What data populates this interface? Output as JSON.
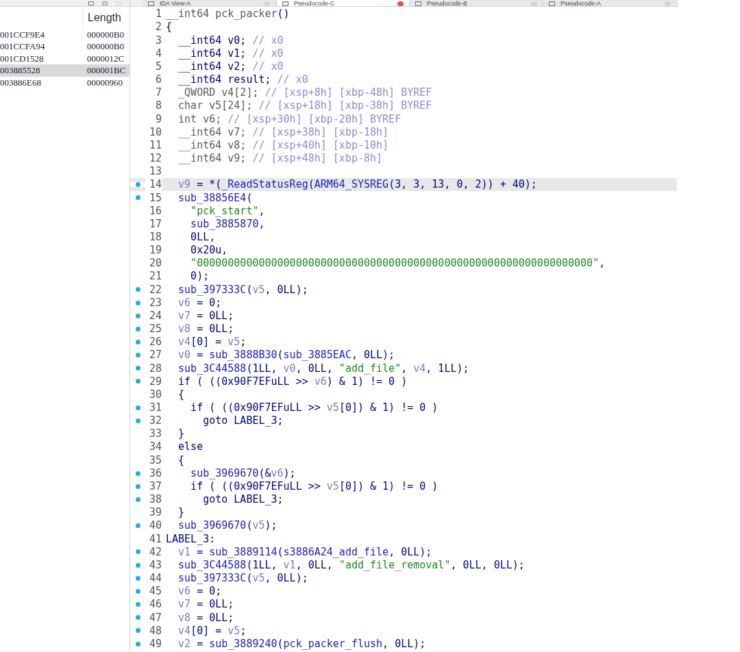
{
  "tabs": [
    {
      "label": "IDA View-A",
      "selected": false
    },
    {
      "label": "Pseudocode-C",
      "selected": true
    },
    {
      "label": "Pseudocode-B",
      "selected": false
    },
    {
      "label": "Pseudocode-A",
      "selected": false
    }
  ],
  "segments": {
    "length_header": "Length",
    "rows": [
      {
        "column_1": "001CCF9E4",
        "length": "000000B0",
        "selected": false
      },
      {
        "column_1": "001CCFA94",
        "length": "000000B0",
        "selected": false
      },
      {
        "column_1": "001CD1528",
        "length": "0000012C",
        "selected": false
      },
      {
        "column_1": "003885528",
        "length": "000001BC",
        "selected": true
      },
      {
        "column_1": "003886E68",
        "length": "00000960",
        "selected": false
      }
    ]
  },
  "code": [
    {
      "num": "1",
      "dot": false,
      "selected": false,
      "tokens": [
        {
          "kind": "gray",
          "text": "__int64 pck_packer"
        },
        {
          "kind": "plain",
          "text": "()"
        }
      ]
    },
    {
      "num": "2",
      "dot": false,
      "selected": false,
      "tokens": [
        {
          "kind": "plain",
          "text": "{"
        }
      ]
    },
    {
      "num": "3",
      "dot": false,
      "selected": false,
      "tokens": [
        {
          "kind": "plain",
          "text": "  __int64 v0; "
        },
        {
          "kind": "comment",
          "text": "// x0"
        }
      ]
    },
    {
      "num": "4",
      "dot": false,
      "selected": false,
      "tokens": [
        {
          "kind": "plain",
          "text": "  __int64 v1; "
        },
        {
          "kind": "comment",
          "text": "// x0"
        }
      ]
    },
    {
      "num": "5",
      "dot": false,
      "selected": false,
      "tokens": [
        {
          "kind": "plain",
          "text": "  __int64 v2; "
        },
        {
          "kind": "comment",
          "text": "// x0"
        }
      ]
    },
    {
      "num": "6",
      "dot": false,
      "selected": false,
      "tokens": [
        {
          "kind": "plain",
          "text": "  __int64 result; "
        },
        {
          "kind": "comment",
          "text": "// x0"
        }
      ]
    },
    {
      "num": "7",
      "dot": false,
      "selected": false,
      "tokens": [
        {
          "kind": "gray",
          "text": "  _QWORD v4[2]; "
        },
        {
          "kind": "comment",
          "text": "// [xsp+8h] [xbp-48h] BYREF"
        }
      ]
    },
    {
      "num": "8",
      "dot": false,
      "selected": false,
      "tokens": [
        {
          "kind": "gray",
          "text": "  char v5[24]; "
        },
        {
          "kind": "comment",
          "text": "// [xsp+18h] [xbp-38h] BYREF"
        }
      ]
    },
    {
      "num": "9",
      "dot": false,
      "selected": false,
      "tokens": [
        {
          "kind": "gray",
          "text": "  int v6; "
        },
        {
          "kind": "comment",
          "text": "// [xsp+30h] [xbp-20h] BYREF"
        }
      ]
    },
    {
      "num": "10",
      "dot": false,
      "selected": false,
      "tokens": [
        {
          "kind": "gray",
          "text": "  __int64 v7; "
        },
        {
          "kind": "comment",
          "text": "// [xsp+38h] [xbp-18h]"
        }
      ]
    },
    {
      "num": "11",
      "dot": false,
      "selected": false,
      "tokens": [
        {
          "kind": "gray",
          "text": "  __int64 v8; "
        },
        {
          "kind": "comment",
          "text": "// [xsp+40h] [xbp-10h]"
        }
      ]
    },
    {
      "num": "12",
      "dot": false,
      "selected": false,
      "tokens": [
        {
          "kind": "gray",
          "text": "  __int64 v9; "
        },
        {
          "kind": "comment",
          "text": "// [xsp+48h] [xbp-8h]"
        }
      ]
    },
    {
      "num": "13",
      "dot": false,
      "selected": false
    },
    {
      "num": "14",
      "dot": true,
      "selected": true,
      "tokens": [
        {
          "kind": "var",
          "text": "  v9"
        },
        {
          "kind": "plain",
          "text": " = *("
        },
        {
          "kind": "name",
          "text": "_ReadStatusReg"
        },
        {
          "kind": "plain",
          "text": "("
        },
        {
          "kind": "name",
          "text": "ARM64_SYSREG"
        },
        {
          "kind": "plain",
          "text": "(3, 3, 13, 0, 2)) + 40);"
        }
      ]
    },
    {
      "num": "15",
      "dot": true,
      "selected": false,
      "tokens": [
        {
          "kind": "name",
          "text": "  sub_38856E4"
        },
        {
          "kind": "plain",
          "text": "("
        }
      ]
    },
    {
      "num": "16",
      "dot": false,
      "selected": false,
      "tokens": [
        {
          "kind": "string",
          "text": "    \"pck_start\""
        },
        {
          "kind": "plain",
          "text": ","
        }
      ]
    },
    {
      "num": "17",
      "dot": false,
      "selected": false,
      "tokens": [
        {
          "kind": "name",
          "text": "    sub_3885870"
        },
        {
          "kind": "plain",
          "text": ","
        }
      ]
    },
    {
      "num": "18",
      "dot": false,
      "selected": false,
      "tokens": [
        {
          "kind": "plain",
          "text": "    0LL,"
        }
      ]
    },
    {
      "num": "19",
      "dot": false,
      "selected": false,
      "tokens": [
        {
          "kind": "plain",
          "text": "    0x20u,"
        }
      ]
    },
    {
      "num": "20",
      "dot": false,
      "selected": false,
      "tokens": [
        {
          "kind": "string",
          "text": "    \"0000000000000000000000000000000000000000000000000000000000000000\""
        },
        {
          "kind": "plain",
          "text": ","
        }
      ]
    },
    {
      "num": "21",
      "dot": false,
      "selected": false,
      "tokens": [
        {
          "kind": "plain",
          "text": "    0);"
        }
      ]
    },
    {
      "num": "22",
      "dot": true,
      "selected": false,
      "tokens": [
        {
          "kind": "name",
          "text": "  sub_397333C"
        },
        {
          "kind": "plain",
          "text": "("
        },
        {
          "kind": "var",
          "text": "v5"
        },
        {
          "kind": "plain",
          "text": ", 0LL);"
        }
      ]
    },
    {
      "num": "23",
      "dot": true,
      "selected": false,
      "tokens": [
        {
          "kind": "var",
          "text": "  v6"
        },
        {
          "kind": "plain",
          "text": " = 0;"
        }
      ]
    },
    {
      "num": "24",
      "dot": true,
      "selected": false,
      "tokens": [
        {
          "kind": "var",
          "text": "  v7"
        },
        {
          "kind": "plain",
          "text": " = 0LL;"
        }
      ]
    },
    {
      "num": "25",
      "dot": true,
      "selected": false,
      "tokens": [
        {
          "kind": "var",
          "text": "  v8"
        },
        {
          "kind": "plain",
          "text": " = 0LL;"
        }
      ]
    },
    {
      "num": "26",
      "dot": true,
      "selected": false,
      "tokens": [
        {
          "kind": "var",
          "text": "  v4"
        },
        {
          "kind": "plain",
          "text": "[0] = "
        },
        {
          "kind": "var",
          "text": "v5"
        },
        {
          "kind": "plain",
          "text": ";"
        }
      ]
    },
    {
      "num": "27",
      "dot": true,
      "selected": false,
      "tokens": [
        {
          "kind": "var",
          "text": "  v0"
        },
        {
          "kind": "plain",
          "text": " = "
        },
        {
          "kind": "name",
          "text": "sub_3888B30"
        },
        {
          "kind": "plain",
          "text": "("
        },
        {
          "kind": "name",
          "text": "sub_3885EAC"
        },
        {
          "kind": "plain",
          "text": ", 0LL);"
        }
      ]
    },
    {
      "num": "28",
      "dot": true,
      "selected": false,
      "tokens": [
        {
          "kind": "name",
          "text": "  sub_3C44588"
        },
        {
          "kind": "plain",
          "text": "(1LL, "
        },
        {
          "kind": "var",
          "text": "v0"
        },
        {
          "kind": "plain",
          "text": ", 0LL, "
        },
        {
          "kind": "string",
          "text": "\"add_file\""
        },
        {
          "kind": "plain",
          "text": ", "
        },
        {
          "kind": "var",
          "text": "v4"
        },
        {
          "kind": "plain",
          "text": ", 1LL);"
        }
      ]
    },
    {
      "num": "29",
      "dot": true,
      "selected": false,
      "tokens": [
        {
          "kind": "plain",
          "text": "  if ( ((0x90F7EFuLL >> "
        },
        {
          "kind": "var",
          "text": "v6"
        },
        {
          "kind": "plain",
          "text": ") & 1) != 0 )"
        }
      ]
    },
    {
      "num": "30",
      "dot": false,
      "selected": false,
      "tokens": [
        {
          "kind": "plain",
          "text": "  {"
        }
      ]
    },
    {
      "num": "31",
      "dot": true,
      "selected": false,
      "tokens": [
        {
          "kind": "plain",
          "text": "    if ( ((0x90F7EFuLL >> "
        },
        {
          "kind": "var",
          "text": "v5"
        },
        {
          "kind": "plain",
          "text": "[0]) & 1) != 0 )"
        }
      ]
    },
    {
      "num": "32",
      "dot": true,
      "selected": false,
      "tokens": [
        {
          "kind": "plain",
          "text": "      goto LABEL_3;"
        }
      ]
    },
    {
      "num": "33",
      "dot": false,
      "selected": false,
      "tokens": [
        {
          "kind": "plain",
          "text": "  }"
        }
      ]
    },
    {
      "num": "34",
      "dot": false,
      "selected": false,
      "tokens": [
        {
          "kind": "plain",
          "text": "  else"
        }
      ]
    },
    {
      "num": "35",
      "dot": false,
      "selected": false,
      "tokens": [
        {
          "kind": "plain",
          "text": "  {"
        }
      ]
    },
    {
      "num": "36",
      "dot": true,
      "selected": false,
      "tokens": [
        {
          "kind": "name",
          "text": "    sub_3969670"
        },
        {
          "kind": "plain",
          "text": "(&"
        },
        {
          "kind": "var",
          "text": "v6"
        },
        {
          "kind": "plain",
          "text": ");"
        }
      ]
    },
    {
      "num": "37",
      "dot": true,
      "selected": false,
      "tokens": [
        {
          "kind": "plain",
          "text": "    if ( ((0x90F7EFuLL >> "
        },
        {
          "kind": "var",
          "text": "v5"
        },
        {
          "kind": "plain",
          "text": "[0]) & 1) != 0 )"
        }
      ]
    },
    {
      "num": "38",
      "dot": true,
      "selected": false,
      "tokens": [
        {
          "kind": "plain",
          "text": "      goto LABEL_3;"
        }
      ]
    },
    {
      "num": "39",
      "dot": false,
      "selected": false,
      "tokens": [
        {
          "kind": "plain",
          "text": "  }"
        }
      ]
    },
    {
      "num": "40",
      "dot": true,
      "selected": false,
      "tokens": [
        {
          "kind": "name",
          "text": "  sub_3969670"
        },
        {
          "kind": "plain",
          "text": "("
        },
        {
          "kind": "var",
          "text": "v5"
        },
        {
          "kind": "plain",
          "text": ");"
        }
      ]
    },
    {
      "num": "41",
      "dot": false,
      "selected": false,
      "tokens": [
        {
          "kind": "plain",
          "text": "LABEL_3:"
        }
      ]
    },
    {
      "num": "42",
      "dot": true,
      "selected": false,
      "tokens": [
        {
          "kind": "var",
          "text": "  v1"
        },
        {
          "kind": "plain",
          "text": " = "
        },
        {
          "kind": "name",
          "text": "sub_3889114"
        },
        {
          "kind": "plain",
          "text": "("
        },
        {
          "kind": "name",
          "text": "s3886A24_add_file"
        },
        {
          "kind": "plain",
          "text": ", 0LL);"
        }
      ]
    },
    {
      "num": "43",
      "dot": true,
      "selected": false,
      "tokens": [
        {
          "kind": "name",
          "text": "  sub_3C44588"
        },
        {
          "kind": "plain",
          "text": "(1LL, "
        },
        {
          "kind": "var",
          "text": "v1"
        },
        {
          "kind": "plain",
          "text": ", 0LL, "
        },
        {
          "kind": "string",
          "text": "\"add_file_removal\""
        },
        {
          "kind": "plain",
          "text": ", 0LL, 0LL);"
        }
      ]
    },
    {
      "num": "44",
      "dot": true,
      "selected": false,
      "tokens": [
        {
          "kind": "name",
          "text": "  sub_397333C"
        },
        {
          "kind": "plain",
          "text": "("
        },
        {
          "kind": "var",
          "text": "v5"
        },
        {
          "kind": "plain",
          "text": ", 0LL);"
        }
      ]
    },
    {
      "num": "45",
      "dot": true,
      "selected": false,
      "tokens": [
        {
          "kind": "var",
          "text": "  v6"
        },
        {
          "kind": "plain",
          "text": " = 0;"
        }
      ]
    },
    {
      "num": "46",
      "dot": true,
      "selected": false,
      "tokens": [
        {
          "kind": "var",
          "text": "  v7"
        },
        {
          "kind": "plain",
          "text": " = 0LL;"
        }
      ]
    },
    {
      "num": "47",
      "dot": true,
      "selected": false,
      "tokens": [
        {
          "kind": "var",
          "text": "  v8"
        },
        {
          "kind": "plain",
          "text": " = 0LL;"
        }
      ]
    },
    {
      "num": "48",
      "dot": true,
      "selected": false,
      "tokens": [
        {
          "kind": "var",
          "text": "  v4"
        },
        {
          "kind": "plain",
          "text": "[0] = "
        },
        {
          "kind": "var",
          "text": "v5"
        },
        {
          "kind": "plain",
          "text": ";"
        }
      ]
    },
    {
      "num": "49",
      "dot": true,
      "selected": false,
      "tokens": [
        {
          "kind": "var",
          "text": "  v2"
        },
        {
          "kind": "plain",
          "text": " = "
        },
        {
          "kind": "name",
          "text": "sub_3889240"
        },
        {
          "kind": "plain",
          "text": "("
        },
        {
          "kind": "name",
          "text": "pck_packer_flush"
        },
        {
          "kind": "plain",
          "text": ", 0LL);"
        }
      ]
    }
  ]
}
